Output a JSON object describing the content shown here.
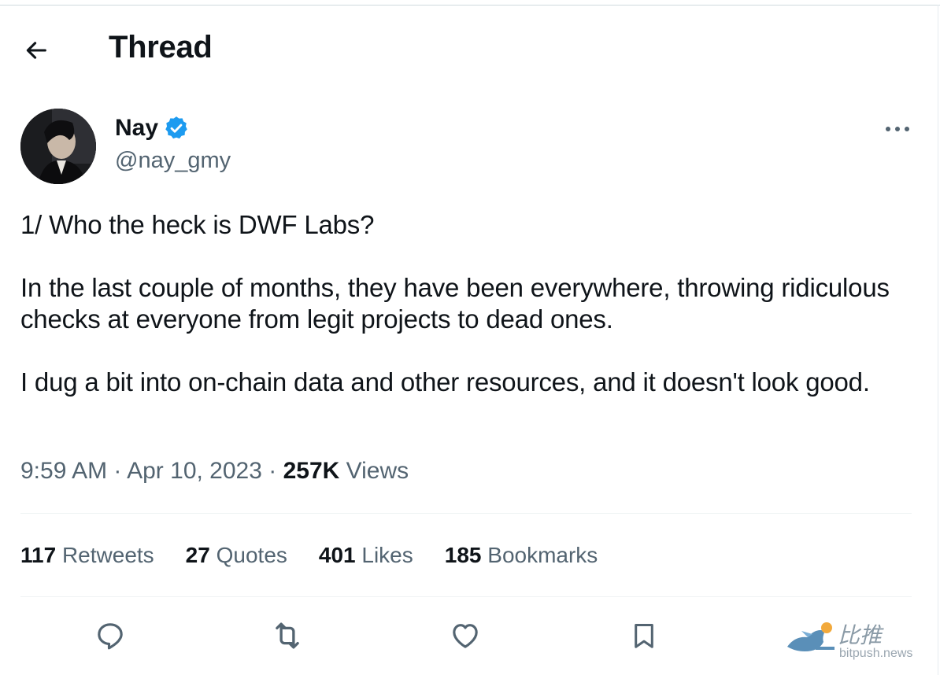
{
  "header": {
    "title": "Thread"
  },
  "author": {
    "name": "Nay",
    "handle": "@nay_gmy",
    "verified": true
  },
  "tweet": {
    "paragraphs": [
      "1/ Who the heck is DWF Labs?",
      "In the last couple of months, they have been everywhere, throwing ridiculous checks at everyone from legit projects to dead ones.",
      "I dug a bit into on-chain data and other resources, and it doesn't look good."
    ]
  },
  "meta": {
    "time": "9:59 AM",
    "sep": "·",
    "date": "Apr 10, 2023",
    "views_count": "257K",
    "views_label": "Views"
  },
  "stats": {
    "retweets": {
      "count": "117",
      "label": "Retweets"
    },
    "quotes": {
      "count": "27",
      "label": "Quotes"
    },
    "likes": {
      "count": "401",
      "label": "Likes"
    },
    "bookmarks": {
      "count": "185",
      "label": "Bookmarks"
    }
  },
  "actions": [
    "reply-icon",
    "retweet-icon",
    "like-icon",
    "bookmark-icon"
  ],
  "watermark": {
    "cn": "比推",
    "url": "bitpush.news"
  },
  "colors": {
    "text": "#0f1419",
    "secondary": "#536471",
    "verified": "#1d9bf0",
    "divider": "#eff3f4"
  }
}
